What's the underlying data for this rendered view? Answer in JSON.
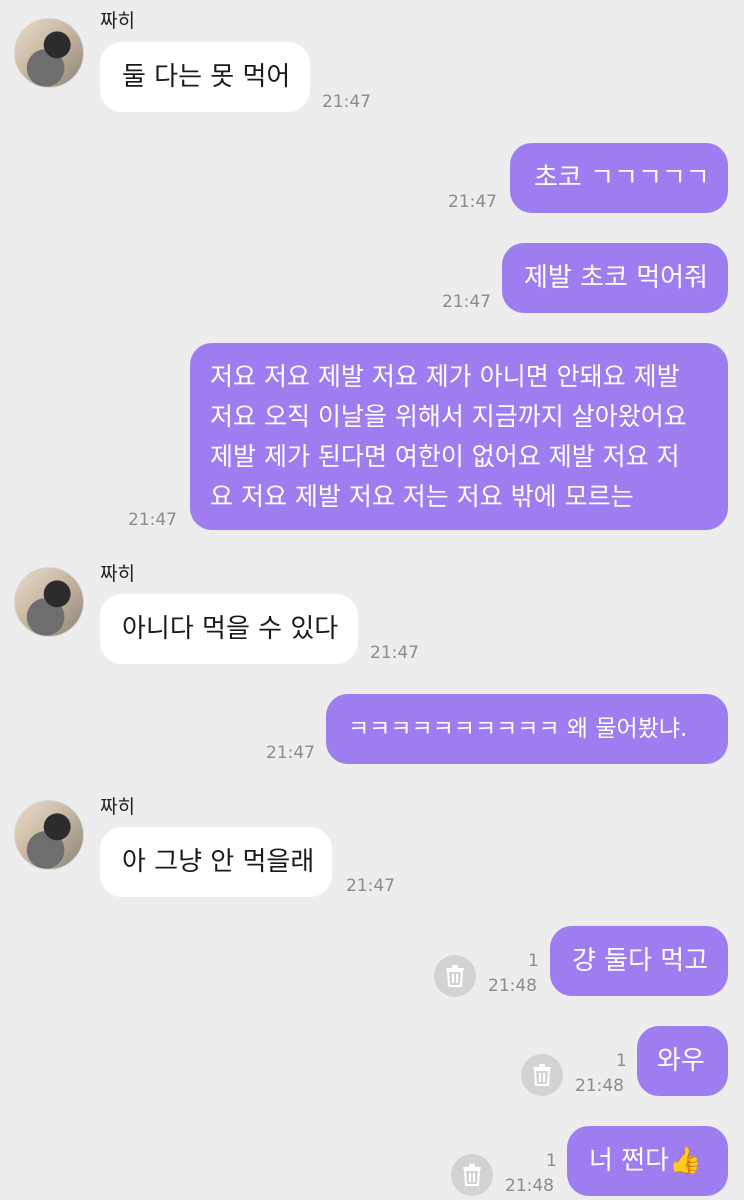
{
  "messages": [
    {
      "sender": "짜히",
      "text": "둘 다는 못 먹어",
      "time": "21:47"
    },
    {
      "text": "초코 ㄱㄱㄱㄱㄱ",
      "time": "21:47"
    },
    {
      "text": "제발 초코 먹어줘",
      "time": "21:47"
    },
    {
      "lines": [
        "저요 저요 제발 저요 제가 아니면 안돼요 제발",
        "저요 오직 이날을 위해서 지금까지 살아왔어요",
        "제발 제가 된다면 여한이 없어요 제발 저요 저",
        "요 저요 제발 저요 저는 저요 밖에 모르는"
      ],
      "time": "21:47"
    },
    {
      "sender": "짜히",
      "text": "아니다 먹을 수 있다",
      "time": "21:47"
    },
    {
      "text": "ㅋㅋㅋㅋㅋㅋㅋㅋㅋㅋ 왜 물어봤냐.",
      "time": "21:47"
    },
    {
      "sender": "짜히",
      "text": "아 그냥 안 먹을래",
      "time": "21:47"
    },
    {
      "text": "걍 둘다 먹고",
      "time": "21:48",
      "unread": "1"
    },
    {
      "text": "와우",
      "time": "21:48",
      "unread": "1"
    },
    {
      "text": "너 쩐다👍",
      "time": "21:48",
      "unread": "1"
    }
  ],
  "colors": {
    "outgoing_bubble": "#9d7df0",
    "incoming_bubble": "#ffffff",
    "background": "#ededed"
  }
}
